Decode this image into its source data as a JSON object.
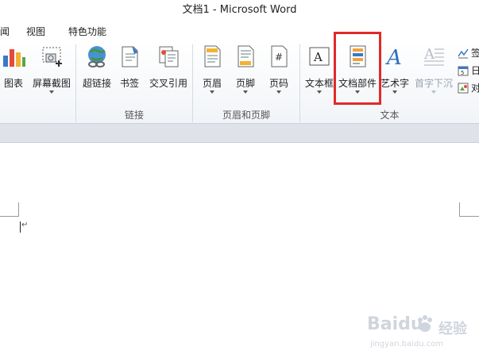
{
  "window": {
    "title": "文档1  -  Microsoft Word"
  },
  "menu": {
    "items": [
      "闻",
      "视图",
      "特色功能"
    ]
  },
  "ribbon": {
    "illustrations": {
      "chart_label": "图表",
      "screenshot_label": "屏幕截图"
    },
    "links": {
      "hyperlink_label": "超链接",
      "bookmark_label": "书签",
      "crossref_label": "交叉引用",
      "group_label": "链接"
    },
    "header_footer": {
      "header_label": "页眉",
      "footer_label": "页脚",
      "pagenum_label": "页码",
      "group_label": "页眉和页脚"
    },
    "text": {
      "textbox_label": "文本框",
      "quickparts_label": "文档部件",
      "wordart_label": "艺术字",
      "dropcap_label": "首字下沉",
      "signature_label": "签",
      "datetime_label": "日",
      "object_label": "对",
      "group_label": "文本"
    }
  },
  "document": {
    "paragraph_mark": "↵"
  },
  "watermark": {
    "brand": "Baidu",
    "brand2": "经验",
    "url": "jingyan.baidu.com"
  },
  "colors": {
    "highlight": "#e02a2a",
    "ribbon_bg": "#f1f4f8",
    "disabled": "#9aa3ad"
  }
}
